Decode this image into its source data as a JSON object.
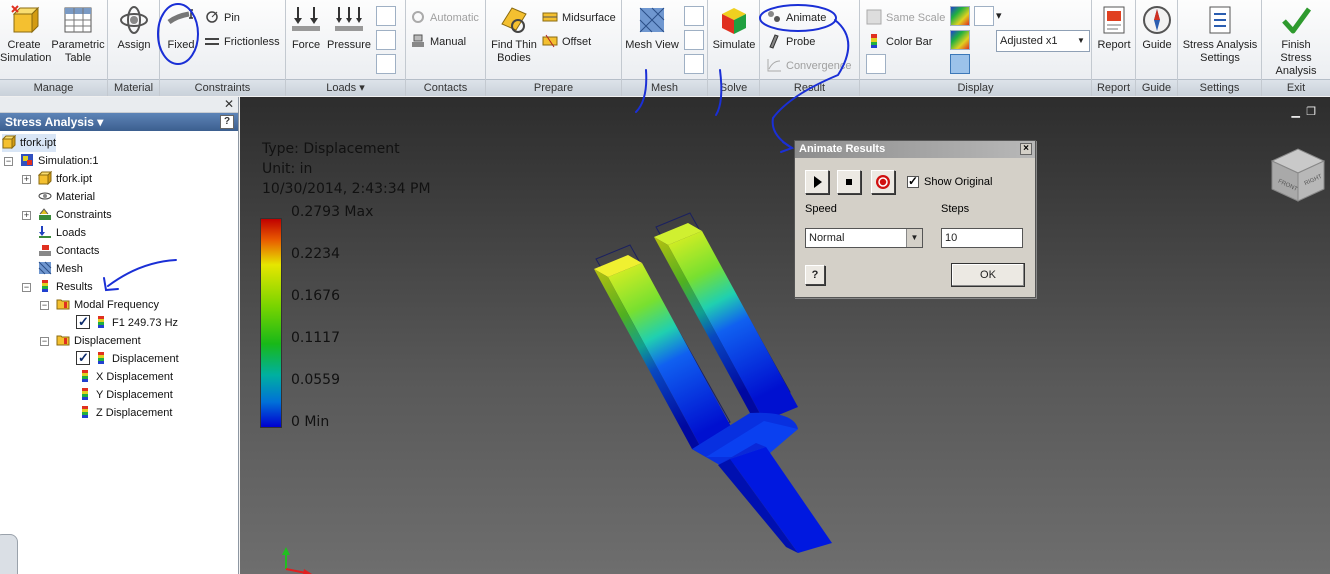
{
  "ribbon": {
    "manage": {
      "title": "Manage",
      "create_simulation": "Create\nSimulation",
      "parametric_table": "Parametric\nTable"
    },
    "material": {
      "title": "Material",
      "assign": "Assign"
    },
    "constraints": {
      "title": "Constraints",
      "fixed": "Fixed",
      "pin": "Pin",
      "frictionless": "Frictionless"
    },
    "loads": {
      "title": "Loads",
      "force": "Force",
      "pressure": "Pressure"
    },
    "contacts": {
      "title": "Contacts",
      "automatic": "Automatic",
      "manual": "Manual"
    },
    "prepare": {
      "title": "Prepare",
      "find_thin_bodies": "Find Thin\nBodies",
      "midsurface": "Midsurface",
      "offset": "Offset"
    },
    "mesh": {
      "title": "Mesh",
      "mesh_view": "Mesh View"
    },
    "solve": {
      "title": "Solve",
      "simulate": "Simulate"
    },
    "result": {
      "title": "Result",
      "animate": "Animate",
      "probe": "Probe",
      "convergence": "Convergence"
    },
    "display": {
      "title": "Display",
      "same_scale": "Same Scale",
      "color_bar": "Color Bar",
      "adjusted": "Adjusted x1"
    },
    "report": {
      "title": "Report",
      "report": "Report"
    },
    "guide": {
      "title": "Guide",
      "guide": "Guide"
    },
    "settings": {
      "title": "Settings",
      "stress_settings": "Stress Analysis\nSettings"
    },
    "exit": {
      "title": "Exit",
      "finish": "Finish\nStress Analysis"
    }
  },
  "browser": {
    "header": "Stress Analysis",
    "items": [
      {
        "label": "tfork.ipt"
      },
      {
        "label": "Simulation:1"
      },
      {
        "label": "tfork.ipt"
      },
      {
        "label": "Material"
      },
      {
        "label": "Constraints"
      },
      {
        "label": "Loads"
      },
      {
        "label": "Contacts"
      },
      {
        "label": "Mesh"
      },
      {
        "label": "Results"
      },
      {
        "label": "Modal Frequency"
      },
      {
        "label": "F1  249.73 Hz"
      },
      {
        "label": "Displacement"
      },
      {
        "label": "Displacement"
      },
      {
        "label": "X Displacement"
      },
      {
        "label": "Y Displacement"
      },
      {
        "label": "Z Displacement"
      }
    ]
  },
  "viewport": {
    "type_line": "Type: Displacement",
    "unit_line": "Unit: in",
    "timestamp": "10/30/2014, 2:43:34 PM",
    "legend": [
      "0.2793 Max",
      "0.2234",
      "0.1676",
      "0.1117",
      "0.0559",
      "0 Min"
    ],
    "viewcube_right": "RIGHT",
    "viewcube_front": "FRONT"
  },
  "dialog": {
    "title": "Animate Results",
    "show_original": "Show Original",
    "speed_label": "Speed",
    "steps_label": "Steps",
    "speed_value": "Normal",
    "steps_value": "10",
    "ok": "OK"
  },
  "colors": {
    "ribbon_bg": "#e8ebef",
    "browser_header": "#3c5f8f",
    "dialog_bg": "#d4d0c8",
    "annotation_ink": "#1a2fd6"
  }
}
